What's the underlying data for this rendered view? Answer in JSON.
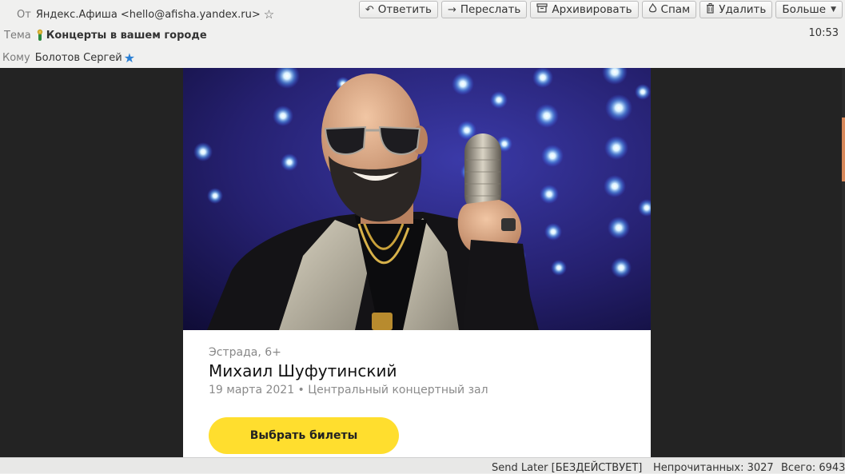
{
  "header": {
    "from_label": "От",
    "from_value": "Яндекс.Афиша <hello@afisha.yandex.ru>",
    "subject_label": "Тема",
    "subject_value": "Концерты в вашем городе",
    "to_label": "Кому",
    "to_value": "Болотов Сергей",
    "time": "10:53",
    "icons": {
      "from_star": "star-outline-icon",
      "subject_emoji": "microphone-emoji-icon",
      "to_star": "star-filled-blue-icon"
    }
  },
  "toolbar": {
    "reply_label": "Ответить",
    "forward_label": "Переслать",
    "archive_label": "Архивировать",
    "spam_label": "Спам",
    "delete_label": "Удалить",
    "more_label": "Больше"
  },
  "email": {
    "genre": "Эстрада, 6+",
    "artist": "Михаил Шуфутинский",
    "details": "19 марта 2021 • Центральный концертный зал",
    "cta_label": "Выбрать билеты"
  },
  "status_bar": {
    "send_later": "Send Later [БЕЗДЕЙСТВУЕТ]",
    "unread": "Непрочитанных: 3027",
    "total": "Всего: 6943"
  },
  "colors": {
    "cta_background": "#ffde2e",
    "hero_background": "#2a1f6e",
    "body_background": "#232323",
    "accent_star": "#2a7fd4"
  }
}
